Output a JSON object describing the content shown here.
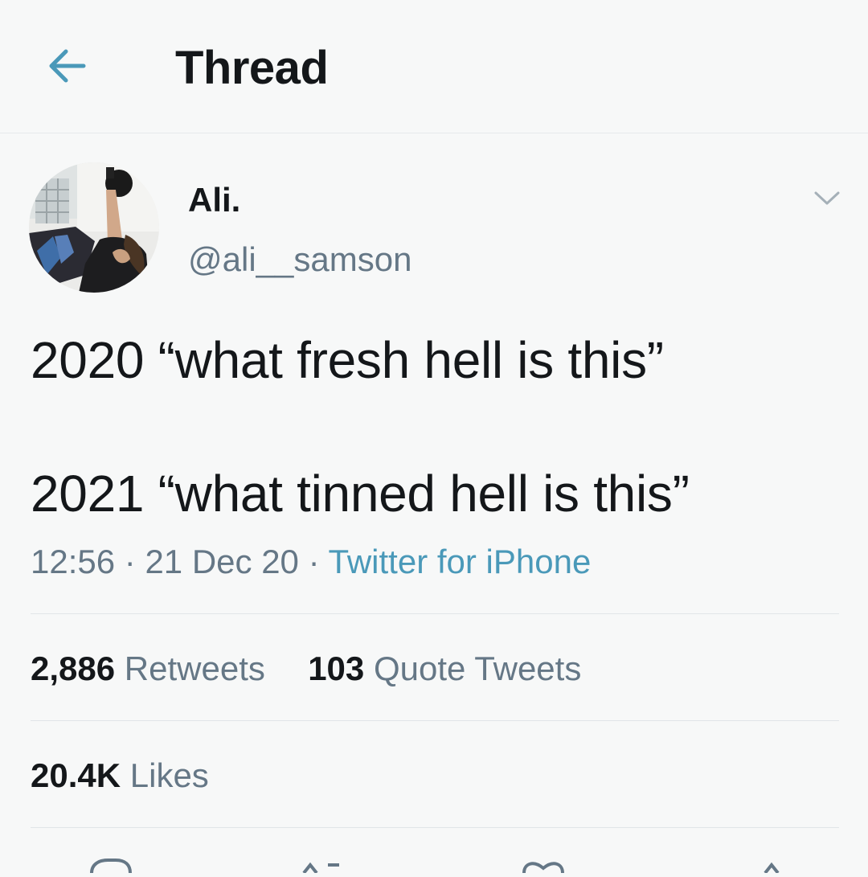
{
  "header": {
    "title": "Thread",
    "back_icon": "arrow-left-icon",
    "accent_color": "#4a99b9"
  },
  "tweet": {
    "author": {
      "display_name": "Ali.",
      "handle": "@ali__samson"
    },
    "menu_icon": "chevron-down-icon",
    "text_lines": [
      "2020 “what fresh hell is this”",
      "2021 “what tinned hell is this”"
    ],
    "time": "12:56",
    "date": "21 Dec 20",
    "separator": "·",
    "source": "Twitter for iPhone",
    "stats": {
      "retweets_count": "2,886",
      "retweets_label": "Retweets",
      "quote_count": "103",
      "quote_label": "Quote Tweets",
      "likes_count": "20.4K",
      "likes_label": "Likes"
    },
    "actions": [
      "reply-icon",
      "retweet-icon",
      "like-icon",
      "share-icon"
    ]
  }
}
